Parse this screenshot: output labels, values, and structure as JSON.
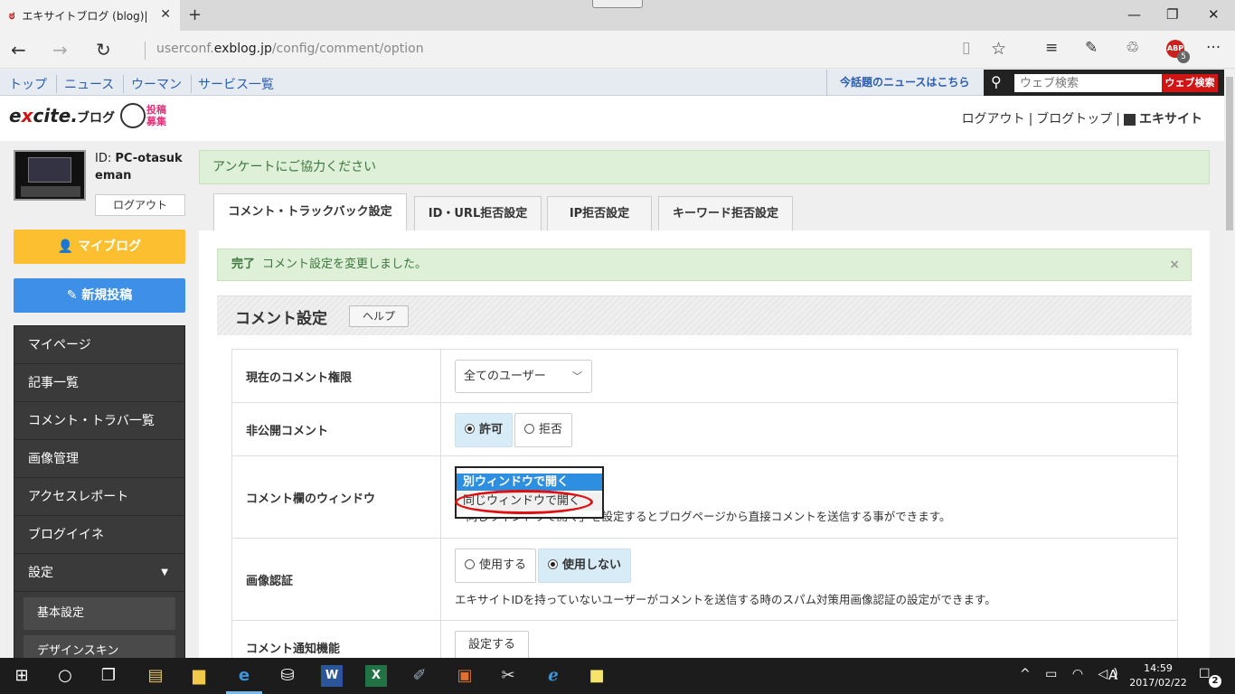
{
  "browser": {
    "tab_title": "エキサイトブログ (blog)|コメ",
    "url_prefix": "userconf.",
    "url_domain": "exblog.jp",
    "url_path": "/config/comment/option",
    "abp_label": "ABP",
    "abp_count": "5"
  },
  "excite_bar": {
    "links": [
      "トップ",
      "ニュース",
      "ウーマン",
      "サービス一覧"
    ],
    "hot_news": "今話題のニュースはこちら",
    "search_placeholder": "ウェブ検索",
    "search_button": "ウェブ検索"
  },
  "header": {
    "logo_prefix": "e",
    "logo_x": "x",
    "logo_suffix": "cite.",
    "blog": "ブログ",
    "toko": "投稿募集",
    "logout": "ログアウト",
    "blog_top": "ブログトップ",
    "excite_site": "エキサイト"
  },
  "sidebar": {
    "id_label": "ID:",
    "user_id": "PC-otasukeman",
    "logout": "ログアウト",
    "my_blog": "マイブログ",
    "new_post": "新規投稿",
    "menu": [
      "マイページ",
      "記事一覧",
      "コメント・トラバ一覧",
      "画像管理",
      "アクセスレポート",
      "ブログイイネ",
      "設定"
    ],
    "submenu": [
      "基本設定",
      "デザインスキン"
    ]
  },
  "main": {
    "survey": "アンケートにご協力ください",
    "tabs": [
      "コメント・トラックバック設定",
      "ID・URL拒否設定",
      "IP拒否設定",
      "キーワード拒否設定"
    ],
    "alert_title": "完了",
    "alert_text": "コメント設定を変更しました。",
    "alert_close": "×",
    "section_title": "コメント設定",
    "help": "ヘルプ",
    "rows": {
      "permission_label": "現在のコメント権限",
      "permission_value": "全てのユーザー",
      "private_label": "非公開コメント",
      "private_allow": "許可",
      "private_deny": "拒否",
      "window_label": "コメント欄のウィンドウ",
      "window_option_selected": "別ウィンドウで開く",
      "window_option_other": "同じウィンドウで開く",
      "window_note": "「同じウィンドウで開く」を設定するとブログページから直接コメントを送信する事ができます。",
      "captcha_label": "画像認証",
      "captcha_use": "使用する",
      "captcha_nouse": "使用しない",
      "captcha_note": "エキサイトIDを持っていないユーザーがコメントを送信する時のスパム対策用画像認証の設定ができます。",
      "notify_label": "コメント通知機能",
      "notify_button": "設定する"
    }
  },
  "taskbar": {
    "time": "14:59",
    "date": "2017/02/22",
    "ime": "A",
    "notifications": "2"
  }
}
